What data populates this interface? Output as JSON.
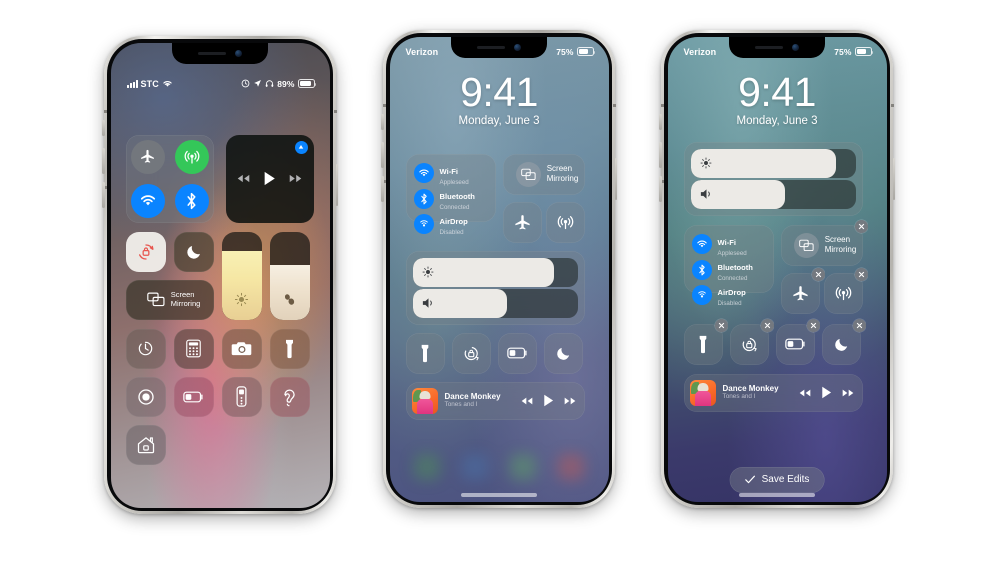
{
  "phones": [
    {
      "id": "phone-1",
      "status": {
        "carrier": "STC",
        "battery_percent": "89%",
        "icons": [
          "signal-bars-icon",
          "wifi-icon",
          "alarm-icon",
          "location-arrow-icon",
          "headphones-icon",
          "battery-icon"
        ]
      },
      "connectivity": [
        {
          "name": "airplane-mode",
          "state": "off"
        },
        {
          "name": "cellular-data",
          "state": "on"
        },
        {
          "name": "wifi",
          "state": "on"
        },
        {
          "name": "bluetooth",
          "state": "on"
        }
      ],
      "media": {
        "airplay_badge": true,
        "controls": [
          "rewind",
          "play",
          "fast-forward"
        ]
      },
      "toggles_row2": [
        {
          "name": "rotation-lock",
          "state": "on"
        },
        {
          "name": "do-not-disturb",
          "state": "off"
        }
      ],
      "screen_mirroring": {
        "label_line1": "Screen",
        "label_line2": "Mirroring"
      },
      "sliders": [
        {
          "name": "brightness",
          "value": 78
        },
        {
          "name": "hearing",
          "value": 62
        }
      ],
      "toggles_grid": [
        "timer-icon",
        "calculator-icon",
        "camera-icon",
        "flashlight-icon",
        "screen-record-icon",
        "low-power-icon",
        "apple-tv-remote-icon",
        "hearing-icon",
        "home-icon"
      ]
    },
    {
      "id": "phone-2",
      "status": {
        "carrier": "Verizon",
        "battery_percent": "75%"
      },
      "clock": {
        "time": "9:41",
        "date": "Monday, June 3"
      },
      "connectivity": [
        {
          "icon": "wifi-icon",
          "title": "Wi-Fi",
          "subtitle": "Appleseed"
        },
        {
          "icon": "bluetooth-icon",
          "title": "Bluetooth",
          "subtitle": "Connected"
        },
        {
          "icon": "airdrop-icon",
          "title": "AirDrop",
          "subtitle": "Disabled"
        }
      ],
      "screen_mirroring": {
        "label_line1": "Screen",
        "label_line2": "Mirroring"
      },
      "quick_toggles": [
        "airplane-icon",
        "cellular-icon"
      ],
      "sliders": [
        {
          "name": "brightness",
          "value": 86
        },
        {
          "name": "volume",
          "value": 57
        }
      ],
      "toggles": [
        "flashlight-icon",
        "rotation-lock-icon",
        "low-power-icon",
        "do-not-disturb-icon"
      ],
      "now_playing": {
        "title": "Dance Monkey",
        "artist": "Tones and I",
        "controls": [
          "rewind",
          "play",
          "fast-forward"
        ]
      }
    },
    {
      "id": "phone-3",
      "edit_mode": true,
      "status": {
        "carrier": "Verizon",
        "battery_percent": "75%"
      },
      "clock": {
        "time": "9:41",
        "date": "Monday, June 3"
      },
      "sliders": [
        {
          "name": "brightness",
          "value": 88
        },
        {
          "name": "volume",
          "value": 57
        }
      ],
      "connectivity": [
        {
          "icon": "wifi-icon",
          "title": "Wi-Fi",
          "subtitle": "Appleseed"
        },
        {
          "icon": "bluetooth-icon",
          "title": "Bluetooth",
          "subtitle": "Connected"
        },
        {
          "icon": "airdrop-icon",
          "title": "AirDrop",
          "subtitle": "Disabled"
        }
      ],
      "screen_mirroring": {
        "label_line1": "Screen",
        "label_line2": "Mirroring",
        "removable": true
      },
      "quick_toggles": [
        {
          "icon": "airplane-icon",
          "removable": true
        },
        {
          "icon": "cellular-icon",
          "removable": true
        }
      ],
      "toggles": [
        {
          "icon": "flashlight-icon",
          "removable": true
        },
        {
          "icon": "rotation-lock-icon",
          "removable": true
        },
        {
          "icon": "low-power-icon",
          "removable": true
        },
        {
          "icon": "do-not-disturb-icon",
          "removable": true
        }
      ],
      "now_playing": {
        "title": "Dance Monkey",
        "artist": "Tones and I",
        "controls": [
          "rewind",
          "play",
          "fast-forward"
        ]
      },
      "save_button": {
        "label": "Save Edits",
        "icon": "checkmark-icon"
      }
    }
  ],
  "colors": {
    "accent_blue": "#0a84ff",
    "accent_green": "#34c759",
    "toggle_off_gray": "#74787e",
    "slider_track": "#eceae6",
    "rotation_lock_red": "#e8564f"
  }
}
